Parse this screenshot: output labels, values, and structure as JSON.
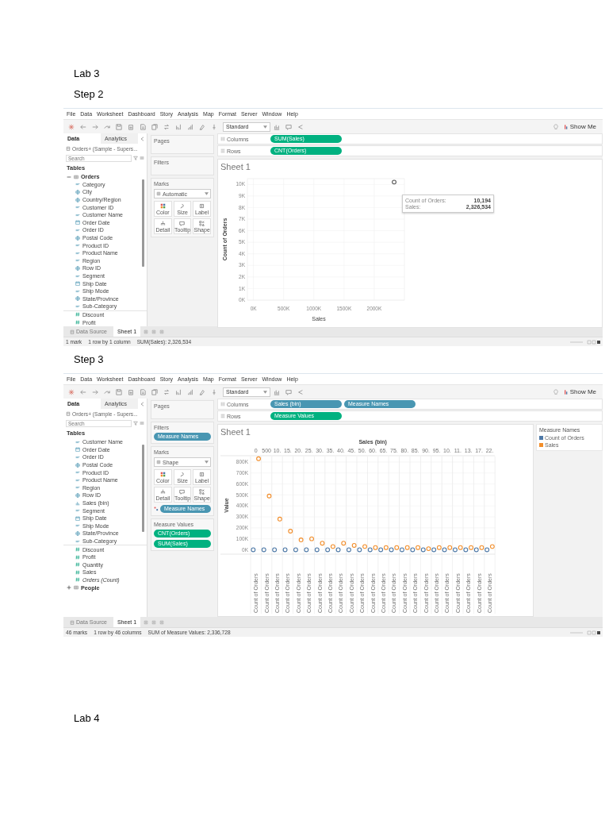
{
  "heading": "Lab 3",
  "steps": [
    {
      "label": "Step 2",
      "app": {
        "menu": [
          "File",
          "Data",
          "Worksheet",
          "Dashboard",
          "Story",
          "Analysis",
          "Map",
          "Format",
          "Server",
          "Window",
          "Help"
        ],
        "toolbar": {
          "fit": "Standard",
          "show_me": "Show Me"
        },
        "data_pane": {
          "tabs": [
            {
              "label": "Data",
              "selected": true
            },
            {
              "label": "Analytics",
              "selected": false
            }
          ],
          "source": "Orders+ (Sample - Supers...",
          "search_placeholder": "Search",
          "tables_heading": "Tables",
          "items": [
            {
              "kind": "table",
              "label": "Orders",
              "expanded": true,
              "children": [
                {
                  "kind": "dimension",
                  "label": "Category"
                },
                {
                  "kind": "geo",
                  "label": "City"
                },
                {
                  "kind": "geo",
                  "label": "Country/Region"
                },
                {
                  "kind": "dimension",
                  "label": "Customer ID"
                },
                {
                  "kind": "dimension",
                  "label": "Customer Name"
                },
                {
                  "kind": "date",
                  "label": "Order Date"
                },
                {
                  "kind": "dimension",
                  "label": "Order ID"
                },
                {
                  "kind": "geo",
                  "label": "Postal Code"
                },
                {
                  "kind": "dimension",
                  "label": "Product ID"
                },
                {
                  "kind": "dimension",
                  "label": "Product Name"
                },
                {
                  "kind": "dimension",
                  "label": "Region"
                },
                {
                  "kind": "geo",
                  "label": "Row ID"
                },
                {
                  "kind": "dimension",
                  "label": "Segment"
                },
                {
                  "kind": "date",
                  "label": "Ship Date"
                },
                {
                  "kind": "dimension",
                  "label": "Ship Mode"
                },
                {
                  "kind": "geo",
                  "label": "State/Province"
                },
                {
                  "kind": "dimension",
                  "label": "Sub-Category"
                },
                {
                  "kind": "measure",
                  "label": "Discount"
                },
                {
                  "kind": "measure",
                  "label": "Profit"
                }
              ]
            }
          ]
        },
        "cards": {
          "pages": "Pages",
          "filters": {
            "title": "Filters"
          },
          "marks": {
            "title": "Marks",
            "mark_type": "Automatic",
            "buttons": [
              "Color",
              "Size",
              "Label",
              "Detail",
              "Tooltip",
              "Shape"
            ]
          }
        },
        "shelves": [
          {
            "label": "Columns",
            "pills": [
              {
                "label": "SUM(Sales)",
                "kind": "continuous"
              }
            ]
          },
          {
            "label": "Rows",
            "pills": [
              {
                "label": "CNT(Orders)",
                "kind": "continuous"
              }
            ]
          }
        ],
        "sheet": {
          "title": "Sheet 1",
          "chart_data": {
            "type": "scatter",
            "xlabel": "Sales",
            "ylabel": "Count of Orders",
            "grid": true,
            "x": [
              2330000
            ],
            "series": [
              {
                "values": [
                  10200
                ]
              }
            ],
            "xlim": [
              -100000,
              2500000
            ],
            "ylim": [
              0,
              10500
            ],
            "xticks": [
              {
                "value": 0,
                "label": "0K"
              },
              {
                "value": 500000,
                "label": "500K"
              },
              {
                "value": 1000000,
                "label": "1000K"
              },
              {
                "value": 1500000,
                "label": "1500K"
              },
              {
                "value": 2000000,
                "label": "2000K"
              }
            ],
            "yticks": [
              {
                "value": 0,
                "label": "0K"
              },
              {
                "value": 1000,
                "label": "1K"
              },
              {
                "value": 2000,
                "label": "2K"
              },
              {
                "value": 3000,
                "label": "3K"
              },
              {
                "value": 4000,
                "label": "4K"
              },
              {
                "value": 5000,
                "label": "5K"
              },
              {
                "value": 6000,
                "label": "6K"
              },
              {
                "value": 7000,
                "label": "7K"
              },
              {
                "value": 8000,
                "label": "8K"
              },
              {
                "value": 9000,
                "label": "9K"
              },
              {
                "value": 10000,
                "label": "10K"
              }
            ]
          },
          "tooltip": [
            {
              "label": "Count of Orders:",
              "value": "10,194"
            },
            {
              "label": "Sales:",
              "value": "2,326,534"
            }
          ]
        },
        "sheet_tabs": [
          {
            "label": "Data Source",
            "selected": false,
            "kind": "data_source"
          },
          {
            "label": "Sheet 1",
            "selected": true,
            "kind": "sheet"
          }
        ],
        "status": [
          "1 mark",
          "1 row by 1 column",
          "SUM(Sales): 2,326,534"
        ]
      }
    },
    {
      "label": "Step 3",
      "app": {
        "menu": [
          "File",
          "Data",
          "Worksheet",
          "Dashboard",
          "Story",
          "Analysis",
          "Map",
          "Format",
          "Server",
          "Window",
          "Help"
        ],
        "toolbar": {
          "fit": "Standard",
          "show_me": "Show Me"
        },
        "data_pane": {
          "tabs": [
            {
              "label": "Data",
              "selected": true
            },
            {
              "label": "Analytics",
              "selected": false
            }
          ],
          "source": "Orders+ (Sample - Supers...",
          "search_placeholder": "Search",
          "tables_heading": "Tables",
          "items": [
            {
              "kind": "dimension",
              "label": "Customer Name"
            },
            {
              "kind": "date",
              "label": "Order Date"
            },
            {
              "kind": "dimension",
              "label": "Order ID"
            },
            {
              "kind": "geo",
              "label": "Postal Code"
            },
            {
              "kind": "dimension",
              "label": "Product ID"
            },
            {
              "kind": "dimension",
              "label": "Product Name"
            },
            {
              "kind": "dimension",
              "label": "Region"
            },
            {
              "kind": "geo",
              "label": "Row ID"
            },
            {
              "kind": "bin",
              "label": "Sales (bin)"
            },
            {
              "kind": "dimension",
              "label": "Segment"
            },
            {
              "kind": "date",
              "label": "Ship Date"
            },
            {
              "kind": "dimension",
              "label": "Ship Mode"
            },
            {
              "kind": "geo",
              "label": "State/Province"
            },
            {
              "kind": "dimension",
              "label": "Sub-Category"
            },
            {
              "kind": "measure",
              "label": "Discount"
            },
            {
              "kind": "measure",
              "label": "Profit"
            },
            {
              "kind": "measure",
              "label": "Quantity"
            },
            {
              "kind": "measure",
              "label": "Sales"
            },
            {
              "kind": "count",
              "label": "Orders (Count)"
            },
            {
              "kind": "table",
              "label": "People",
              "expanded": false
            }
          ]
        },
        "cards": {
          "pages": "Pages",
          "filters": {
            "title": "Filters",
            "pills": [
              {
                "label": "Measure Names",
                "kind": "discrete"
              }
            ]
          },
          "marks": {
            "title": "Marks",
            "mark_type": "Shape",
            "buttons": [
              "Color",
              "Size",
              "Label",
              "Detail",
              "Tooltip",
              "Shape"
            ],
            "pills": [
              {
                "label": "Measure Names",
                "kind": "discrete"
              }
            ]
          },
          "measure_values": {
            "title": "Measure Values",
            "pills": [
              {
                "label": "CNT(Orders)",
                "kind": "continuous"
              },
              {
                "label": "SUM(Sales)",
                "kind": "continuous"
              }
            ]
          }
        },
        "shelves": [
          {
            "label": "Columns",
            "pills": [
              {
                "label": "Sales (bin)",
                "kind": "discrete"
              },
              {
                "label": "Measure Names",
                "kind": "discrete"
              }
            ]
          },
          {
            "label": "Rows",
            "pills": [
              {
                "label": "Measure Values",
                "kind": "continuous"
              }
            ]
          }
        ],
        "sheet": {
          "title": "Sheet 1",
          "chart_data": {
            "type": "scatter",
            "xlabel": "Sales (bin)",
            "ylabel": "Value",
            "grid": true,
            "ylim": [
              -40000,
              850000
            ],
            "categories": [
              "0",
              "500",
              "10.",
              "15.",
              "20.",
              "25.",
              "30.",
              "35.",
              "40.",
              "45.",
              "50.",
              "60.",
              "65.",
              "75.",
              "80.",
              "85.",
              "90.",
              "95.",
              "10.",
              "11.",
              "13.",
              "17.",
              "22."
            ],
            "series": [
              {
                "name": "Count of Orders",
                "color": "#4e79a7",
                "values": [
                  0,
                  0,
                  0,
                  0,
                  0,
                  0,
                  0,
                  0,
                  0,
                  0,
                  0,
                  0,
                  0,
                  0,
                  0,
                  0,
                  0,
                  0,
                  0,
                  0,
                  0,
                  0,
                  0
                ]
              },
              {
                "name": "Sales",
                "color": "#f28e2b",
                "values": [
                  830000,
                  490000,
                  280000,
                  170000,
                  90000,
                  100000,
                  60000,
                  30000,
                  60000,
                  40000,
                  30000,
                  20000,
                  20000,
                  20000,
                  20000,
                  20000,
                  10000,
                  20000,
                  20000,
                  20000,
                  20000,
                  20000,
                  30000
                ]
              }
            ],
            "yticks": [
              {
                "value": 0,
                "label": "0K"
              },
              {
                "value": 100000,
                "label": "100K"
              },
              {
                "value": 200000,
                "label": "200K"
              },
              {
                "value": 300000,
                "label": "300K"
              },
              {
                "value": 400000,
                "label": "400K"
              },
              {
                "value": 500000,
                "label": "500K"
              },
              {
                "value": 600000,
                "label": "600K"
              },
              {
                "value": 700000,
                "label": "700K"
              },
              {
                "value": 800000,
                "label": "800K"
              }
            ]
          },
          "column_labels": [
            "Count of Orders",
            "Count of Orders",
            "Count of Orders",
            "Count of Orders",
            "Count of Orders",
            "Count of Orders",
            "Count of Orders",
            "Count of Orders",
            "Count of Orders",
            "Count of Orders",
            "Count of Orders",
            "Count of Orders",
            "Count of Orders",
            "Count of Orders",
            "Count of Orders",
            "Count of Orders",
            "Count of Orders",
            "Count of Orders",
            "Count of Orders",
            "Count of Orders",
            "Count of Orders",
            "Count of Orders",
            "Count of Orders"
          ],
          "legend_title": "Measure Names"
        },
        "sheet_tabs": [
          {
            "label": "Data Source",
            "selected": false,
            "kind": "data_source"
          },
          {
            "label": "Sheet 1",
            "selected": true,
            "kind": "sheet"
          }
        ],
        "status": [
          "46 marks",
          "1 row by 46 columns",
          "SUM of Measure Values: 2,336,728"
        ]
      }
    }
  ],
  "next_heading": "Lab 4"
}
